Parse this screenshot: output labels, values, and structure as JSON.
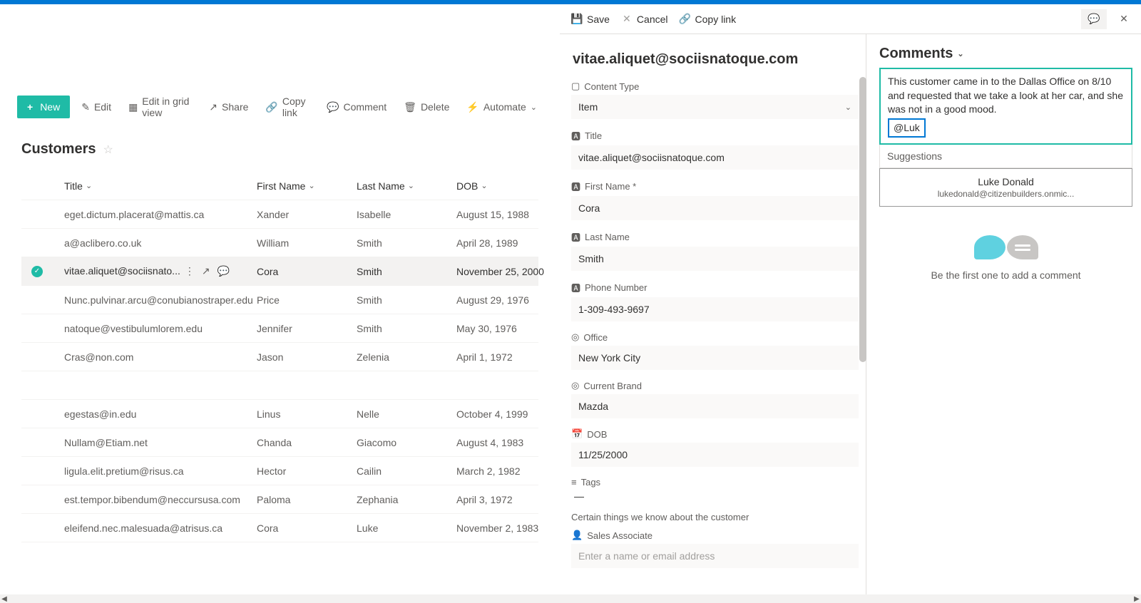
{
  "panelHeader": {
    "save": "Save",
    "cancel": "Cancel",
    "copyLink": "Copy link"
  },
  "commandBar": {
    "new": "New",
    "edit": "Edit",
    "editGrid": "Edit in grid view",
    "share": "Share",
    "copyLink": "Copy link",
    "comment": "Comment",
    "delete": "Delete",
    "automate": "Automate"
  },
  "listTitle": "Customers",
  "columns": {
    "title": "Title",
    "firstName": "First Name",
    "lastName": "Last Name",
    "dob": "DOB"
  },
  "rows": [
    {
      "title": "eget.dictum.placerat@mattis.ca",
      "first": "Xander",
      "last": "Isabelle",
      "dob": "August 15, 1988"
    },
    {
      "title": "a@aclibero.co.uk",
      "first": "William",
      "last": "Smith",
      "dob": "April 28, 1989"
    },
    {
      "title": "vitae.aliquet@sociisnato...",
      "first": "Cora",
      "last": "Smith",
      "dob": "November 25, 2000",
      "selected": true
    },
    {
      "title": "Nunc.pulvinar.arcu@conubianostraper.edu",
      "first": "Price",
      "last": "Smith",
      "dob": "August 29, 1976"
    },
    {
      "title": "natoque@vestibulumlorem.edu",
      "first": "Jennifer",
      "last": "Smith",
      "dob": "May 30, 1976"
    },
    {
      "title": "Cras@non.com",
      "first": "Jason",
      "last": "Zelenia",
      "dob": "April 1, 1972"
    },
    {
      "title": "egestas@in.edu",
      "first": "Linus",
      "last": "Nelle",
      "dob": "October 4, 1999"
    },
    {
      "title": "Nullam@Etiam.net",
      "first": "Chanda",
      "last": "Giacomo",
      "dob": "August 4, 1983"
    },
    {
      "title": "ligula.elit.pretium@risus.ca",
      "first": "Hector",
      "last": "Cailin",
      "dob": "March 2, 1982"
    },
    {
      "title": "est.tempor.bibendum@neccursusa.com",
      "first": "Paloma",
      "last": "Zephania",
      "dob": "April 3, 1972"
    },
    {
      "title": "eleifend.nec.malesuada@atrisus.ca",
      "first": "Cora",
      "last": "Luke",
      "dob": "November 2, 1983"
    }
  ],
  "detail": {
    "heading": "vitae.aliquet@sociisnatoque.com",
    "contentTypeLabel": "Content Type",
    "contentType": "Item",
    "titleLabel": "Title",
    "title": "vitae.aliquet@sociisnatoque.com",
    "firstNameLabel": "First Name *",
    "firstName": "Cora",
    "lastNameLabel": "Last Name",
    "lastName": "Smith",
    "phoneLabel": "Phone Number",
    "phone": "1-309-493-9697",
    "officeLabel": "Office",
    "office": "New York City",
    "brandLabel": "Current Brand",
    "brand": "Mazda",
    "dobLabel": "DOB",
    "dob": "11/25/2000",
    "tagsLabel": "Tags",
    "tags": "—",
    "section": "Certain things we know about the customer",
    "salesAssocLabel": "Sales Associate",
    "salesAssocPlaceholder": "Enter a name or email address"
  },
  "comments": {
    "title": "Comments",
    "draft": "This customer came in to the Dallas Office on 8/10 and requested that we take a look at her car, and she was not in a good mood.",
    "mention": "@Luk",
    "suggestionsLabel": "Suggestions",
    "suggestion": {
      "name": "Luke Donald",
      "email": "lukedonald@citizenbuilders.onmic..."
    },
    "empty": "Be the first one to add a comment"
  }
}
